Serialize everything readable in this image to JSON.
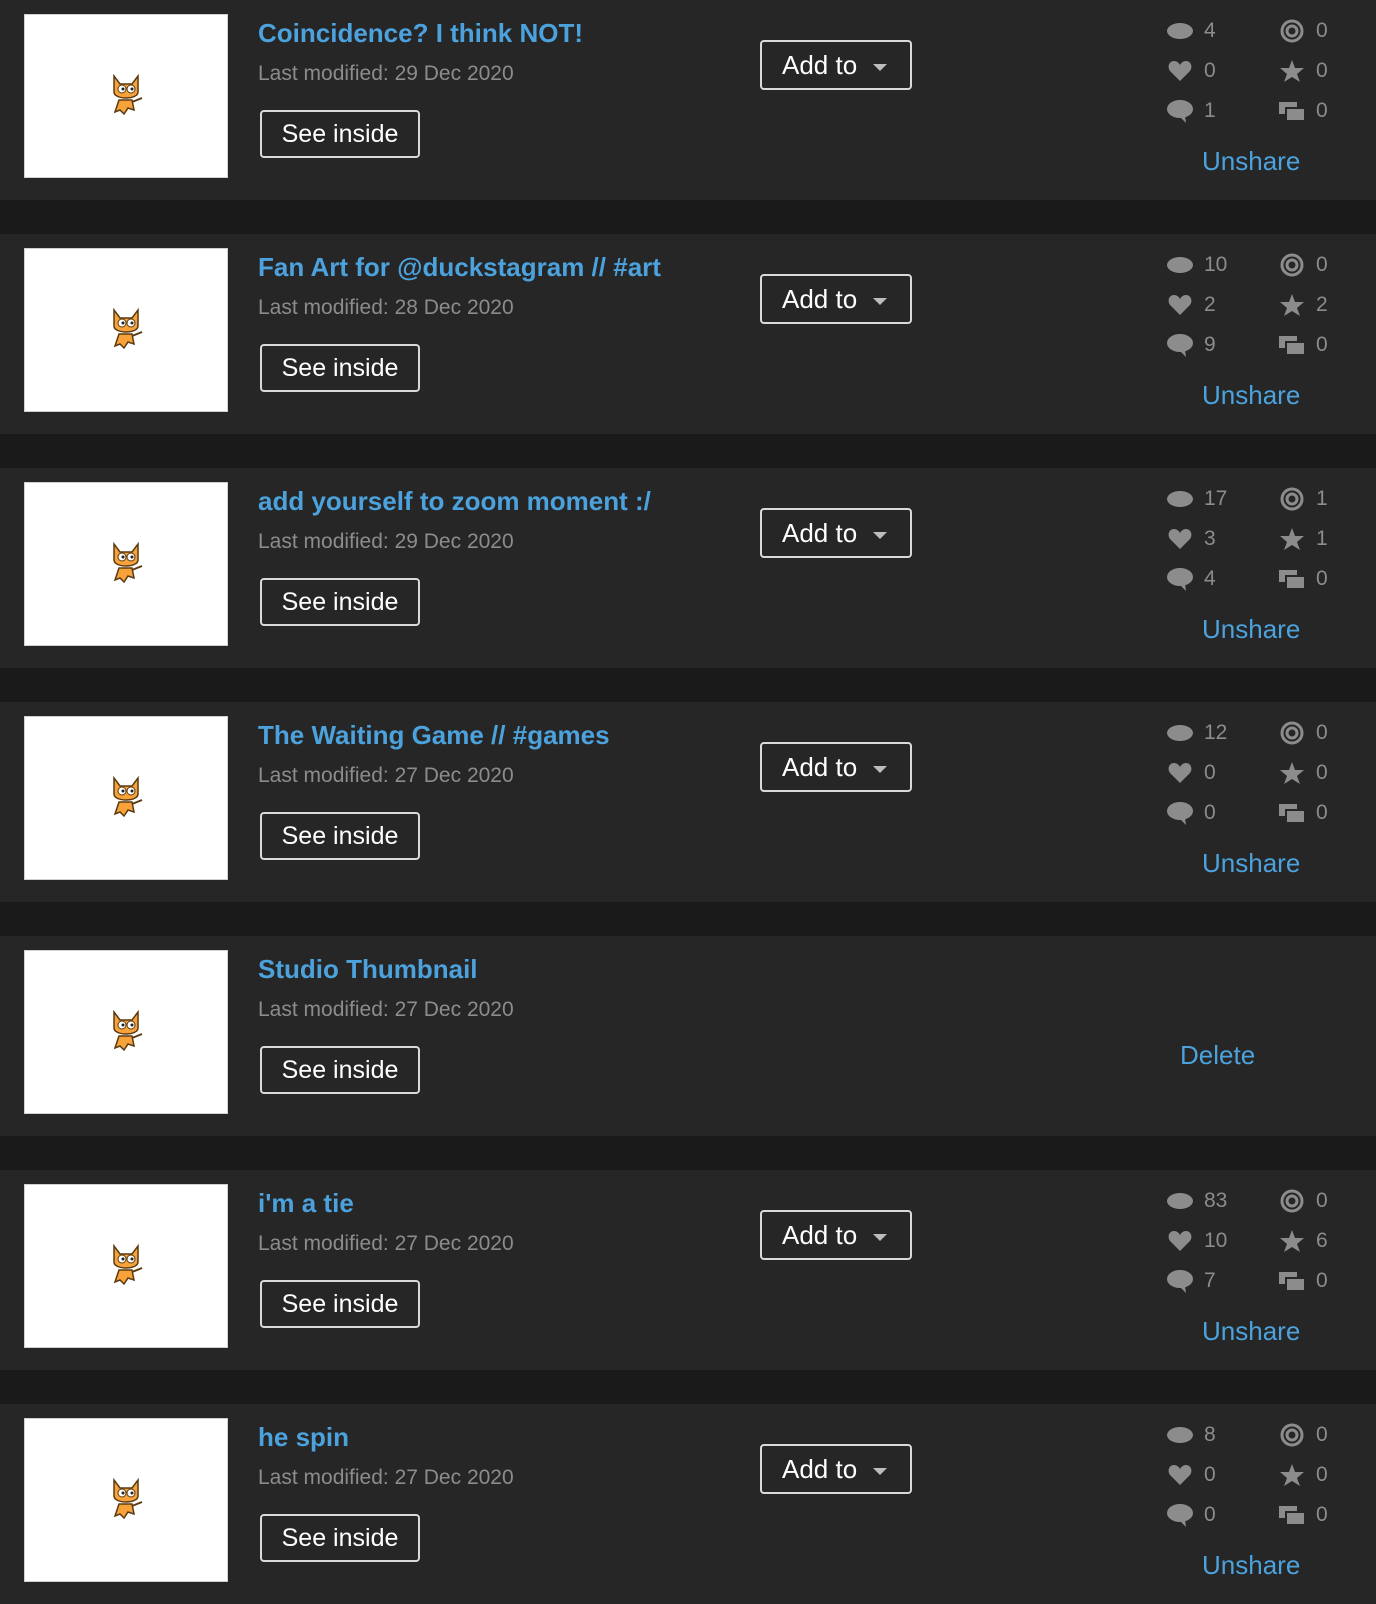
{
  "labels": {
    "see_inside": "See inside",
    "add_to": "Add to",
    "unshare": "Unshare",
    "delete": "Delete"
  },
  "projects": [
    {
      "title": "Coincidence? I think NOT!",
      "modified": "Last modified: 29 Dec 2020",
      "shared": true,
      "views": "4",
      "loves": "0",
      "comments": "1",
      "remixes": "0",
      "favorites": "0",
      "studios": "0"
    },
    {
      "title": "Fan Art for @duckstagram // #art",
      "modified": "Last modified: 28 Dec 2020",
      "shared": true,
      "views": "10",
      "loves": "2",
      "comments": "9",
      "remixes": "0",
      "favorites": "2",
      "studios": "0"
    },
    {
      "title": "add yourself to zoom moment :/",
      "modified": "Last modified: 29 Dec 2020",
      "shared": true,
      "views": "17",
      "loves": "3",
      "comments": "4",
      "remixes": "1",
      "favorites": "1",
      "studios": "0"
    },
    {
      "title": "The Waiting Game // #games",
      "modified": "Last modified: 27 Dec 2020",
      "shared": true,
      "views": "12",
      "loves": "0",
      "comments": "0",
      "remixes": "0",
      "favorites": "0",
      "studios": "0"
    },
    {
      "title": "Studio Thumbnail",
      "modified": "Last modified: 27 Dec 2020",
      "shared": false
    },
    {
      "title": "i'm a tie",
      "modified": "Last modified: 27 Dec 2020",
      "shared": true,
      "views": "83",
      "loves": "10",
      "comments": "7",
      "remixes": "0",
      "favorites": "6",
      "studios": "0"
    },
    {
      "title": "he spin",
      "modified": "Last modified: 27 Dec 2020",
      "shared": true,
      "views": "8",
      "loves": "0",
      "comments": "0",
      "remixes": "0",
      "favorites": "0",
      "studios": "0"
    }
  ],
  "icons": {
    "views": "eye-icon",
    "loves": "heart-icon",
    "comments": "comment-icon",
    "remixes": "remix-icon",
    "favorites": "star-icon",
    "studios": "studio-icon",
    "thumbnail": "scratch-cat-icon"
  },
  "colors": {
    "background": "#1a1a1a",
    "row": "#262626",
    "link": "#4ca2dd",
    "muted": "#8c8c8c"
  }
}
